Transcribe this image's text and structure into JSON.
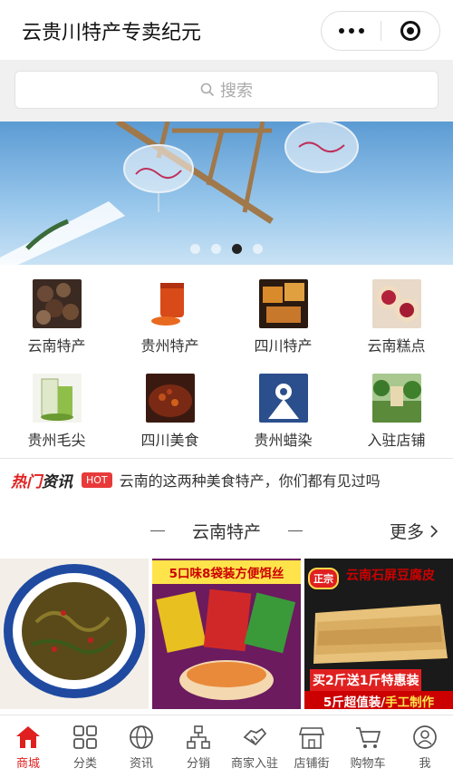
{
  "titlebar": {
    "title": "云贵川特产专卖纪元"
  },
  "search": {
    "placeholder": "搜索"
  },
  "banner": {
    "slide_count": 4,
    "active_slide": 3
  },
  "categories": [
    {
      "label": "云南特产",
      "icon": "yunnan-specialty-thumb"
    },
    {
      "label": "贵州特产",
      "icon": "guizhou-specialty-thumb"
    },
    {
      "label": "四川特产",
      "icon": "sichuan-specialty-thumb"
    },
    {
      "label": "云南糕点",
      "icon": "yunnan-pastry-thumb"
    },
    {
      "label": "贵州毛尖",
      "icon": "guizhou-maojian-tea-thumb"
    },
    {
      "label": "四川美食",
      "icon": "sichuan-food-thumb"
    },
    {
      "label": "贵州蜡染",
      "icon": "guizhou-batik-thumb"
    },
    {
      "label": "入驻店铺",
      "icon": "store-join-thumb"
    }
  ],
  "news": {
    "logo_red": "热门",
    "logo_dark": "资讯",
    "badge": "HOT",
    "headline": "云南的这两种美食特产，你们都有见过吗"
  },
  "section": {
    "title": "云南特产",
    "more": "更多"
  },
  "products": [
    {
      "name": "pickled-vegetable-product"
    },
    {
      "banner": "5口味8袋装方便饵丝"
    },
    {
      "tag": "正宗",
      "title": "云南石屏豆腐皮",
      "promo": "买2斤送1斤特惠装",
      "promo2_a": "5斤超值装/",
      "promo2_b": "手工制作"
    }
  ],
  "tabbar": [
    {
      "label": "商城",
      "icon": "store-home-icon",
      "active": true
    },
    {
      "label": "分类",
      "icon": "grid-category-icon"
    },
    {
      "label": "资讯",
      "icon": "globe-news-icon"
    },
    {
      "label": "分销",
      "icon": "org-chart-icon"
    },
    {
      "label": "商家入驻",
      "icon": "handshake-icon"
    },
    {
      "label": "店铺街",
      "icon": "storefront-icon"
    },
    {
      "label": "购物车",
      "icon": "cart-icon"
    },
    {
      "label": "我",
      "icon": "user-icon"
    }
  ],
  "colors": {
    "accent": "#e02020",
    "search_bg": "#f0f0f0"
  }
}
